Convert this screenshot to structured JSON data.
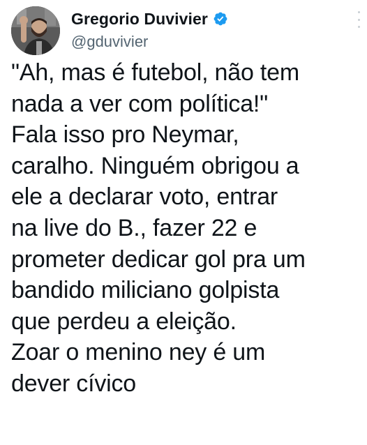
{
  "author": {
    "display_name": "Gregorio Duvivier",
    "handle": "@gduvivier",
    "verified": true,
    "verified_color": "#1d9bf0"
  },
  "tweet": {
    "lines": [
      "\"Ah, mas é futebol, não tem",
      "nada a ver com política!\"",
      "Fala isso pro Neymar,",
      "caralho. Ninguém obrigou a",
      "ele a declarar voto, entrar",
      "na live do B., fazer 22 e",
      "prometer dedicar gol pra um",
      "bandido miliciano golpista",
      "que perdeu a eleição.",
      "Zoar o menino ney é um",
      "dever cívico"
    ]
  },
  "icons": {
    "verified": "verified-badge-icon",
    "more": "more-options-icon"
  },
  "colors": {
    "text": "#0f1419",
    "secondary_text": "#536471",
    "background": "#ffffff"
  }
}
